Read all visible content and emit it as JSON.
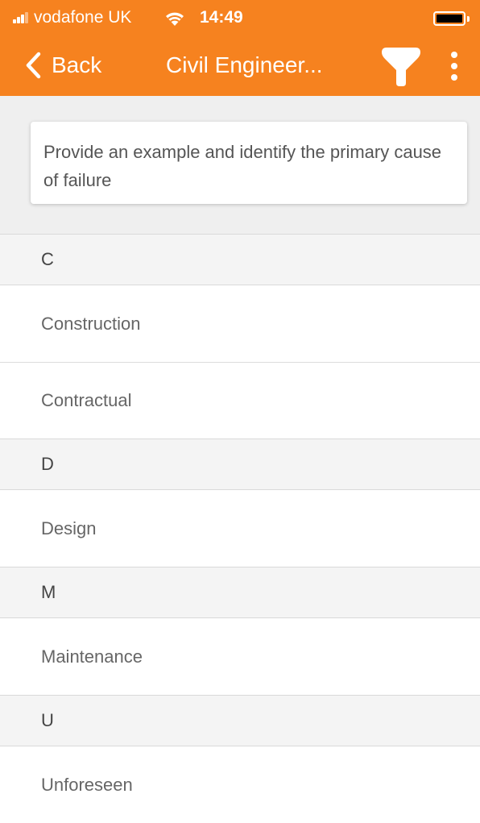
{
  "status_bar": {
    "carrier": "vodafone UK",
    "time": "14:49"
  },
  "nav": {
    "back_label": "Back",
    "title": "Civil Engineer...",
    "filter_icon": "funnel-icon",
    "more_icon": "vertical-ellipsis-icon"
  },
  "question": {
    "text": "Provide an example and identify the primary cause of failure"
  },
  "sections": [
    {
      "letter": "C",
      "items": [
        "Construction",
        "Contractual"
      ]
    },
    {
      "letter": "D",
      "items": [
        "Design"
      ]
    },
    {
      "letter": "M",
      "items": [
        "Maintenance"
      ]
    },
    {
      "letter": "U",
      "items": [
        "Unforeseen"
      ]
    }
  ],
  "colors": {
    "accent": "#f6821f",
    "section_bg": "#f4f4f4",
    "question_bg": "#efefef"
  }
}
